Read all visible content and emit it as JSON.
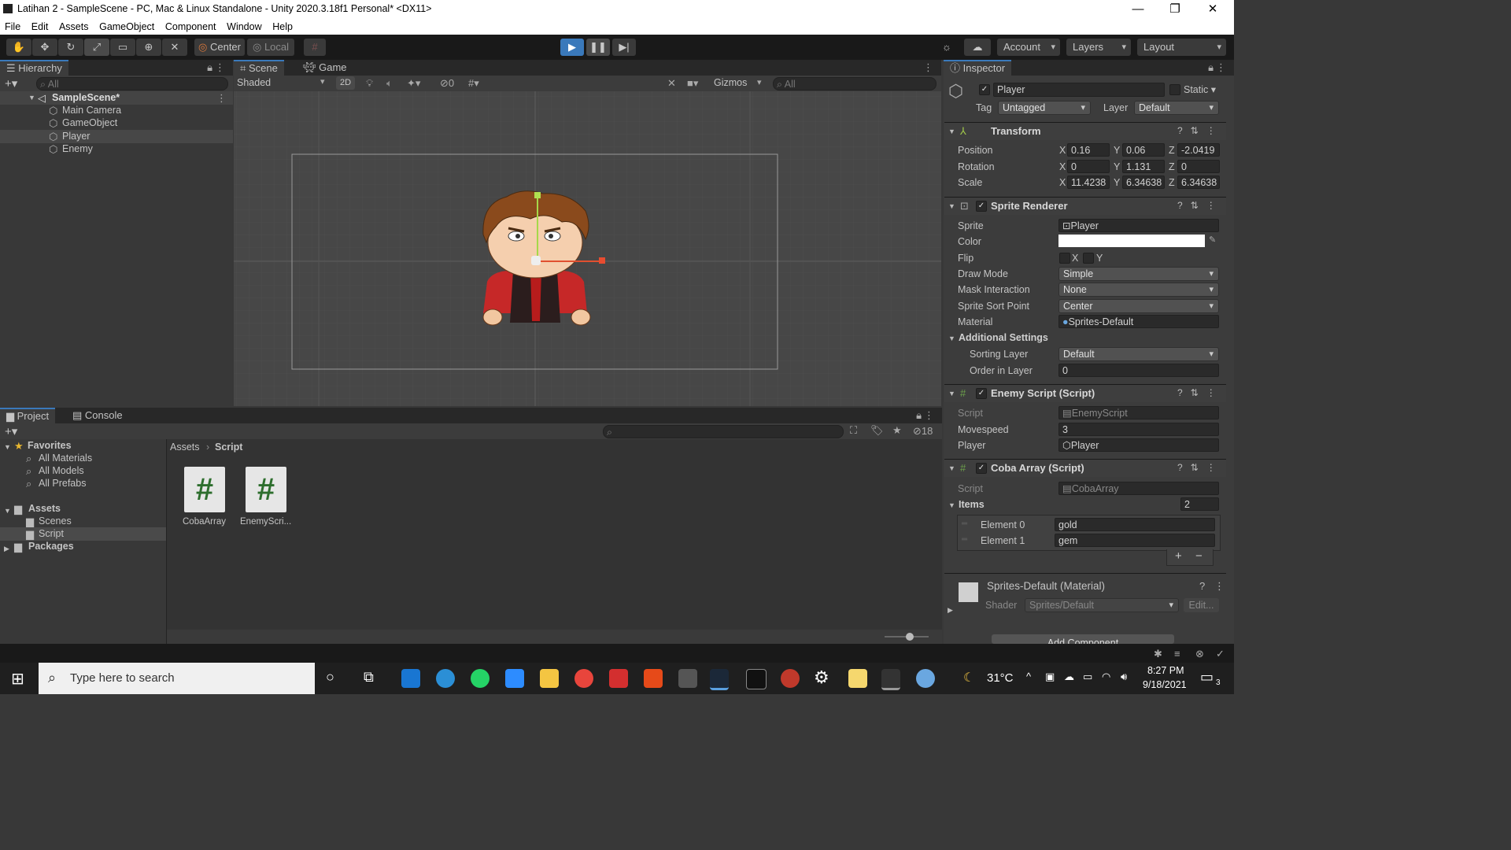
{
  "window": {
    "title": "Latihan 2 - SampleScene - PC, Mac & Linux Standalone - Unity 2020.3.18f1 Personal* <DX11>",
    "minimize": "—",
    "maximize": "❐",
    "close": "✕"
  },
  "menu": [
    "File",
    "Edit",
    "Assets",
    "GameObject",
    "Component",
    "Window",
    "Help"
  ],
  "toolbar": {
    "pivot": "Center",
    "space": "Local",
    "account": "Account",
    "layers": "Layers",
    "layout": "Layout"
  },
  "hierarchy": {
    "tab": "Hierarchy",
    "search_placeholder": "All",
    "scene": "SampleScene*",
    "items": [
      "Main Camera",
      "GameObject",
      "Player",
      "Enemy"
    ]
  },
  "scene_view": {
    "tabs": [
      "Scene",
      "Game"
    ],
    "shading": "Shaded",
    "mode_2d": "2D",
    "hidden_count": "0",
    "gizmos": "Gizmos",
    "search_placeholder": "All"
  },
  "project": {
    "tabs": [
      "Project",
      "Console"
    ],
    "hidden_count": "18",
    "favorites": "Favorites",
    "fav_items": [
      "All Materials",
      "All Models",
      "All Prefabs"
    ],
    "assets": "Assets",
    "asset_folders": [
      "Scenes",
      "Script"
    ],
    "packages": "Packages",
    "breadcrumb": [
      "Assets",
      "Script"
    ],
    "files": [
      "CobaArray",
      "EnemyScri..."
    ]
  },
  "inspector": {
    "tab": "Inspector",
    "object_name": "Player",
    "static_label": "Static",
    "tag_label": "Tag",
    "tag_value": "Untagged",
    "layer_label": "Layer",
    "layer_value": "Default",
    "transform": {
      "title": "Transform",
      "position_label": "Position",
      "px": "0.16",
      "py": "0.06",
      "pz": "-2.0419",
      "rotation_label": "Rotation",
      "rx": "0",
      "ry": "1.131",
      "rz": "0",
      "scale_label": "Scale",
      "sx": "11.4238",
      "sy": "6.34638",
      "sz": "6.34638"
    },
    "sprite_renderer": {
      "title": "Sprite Renderer",
      "sprite_label": "Sprite",
      "sprite_value": "Player",
      "color_label": "Color",
      "flip_label": "Flip",
      "flip_x": "X",
      "flip_y": "Y",
      "draw_mode_label": "Draw Mode",
      "draw_mode": "Simple",
      "mask_label": "Mask Interaction",
      "mask": "None",
      "sort_point_label": "Sprite Sort Point",
      "sort_point": "Center",
      "material_label": "Material",
      "material": "Sprites-Default",
      "additional": "Additional Settings",
      "sorting_layer_label": "Sorting Layer",
      "sorting_layer": "Default",
      "order_label": "Order in Layer",
      "order": "0"
    },
    "enemy_script": {
      "title": "Enemy Script (Script)",
      "script_label": "Script",
      "script": "EnemyScript",
      "movespeed_label": "Movespeed",
      "movespeed": "3",
      "player_label": "Player",
      "player": "Player"
    },
    "coba_array": {
      "title": "Coba Array (Script)",
      "script_label": "Script",
      "script": "CobaArray",
      "items_label": "Items",
      "items_count": "2",
      "elements": [
        {
          "label": "Element 0",
          "value": "gold"
        },
        {
          "label": "Element 1",
          "value": "gem"
        }
      ]
    },
    "material": {
      "title": "Sprites-Default (Material)",
      "shader_label": "Shader",
      "shader": "Sprites/Default",
      "edit": "Edit..."
    },
    "add_component": "Add Component"
  },
  "taskbar": {
    "search_placeholder": "Type here to search",
    "temperature": "31°C",
    "time": "8:27 PM",
    "date": "9/18/2021",
    "notifications": "3"
  }
}
